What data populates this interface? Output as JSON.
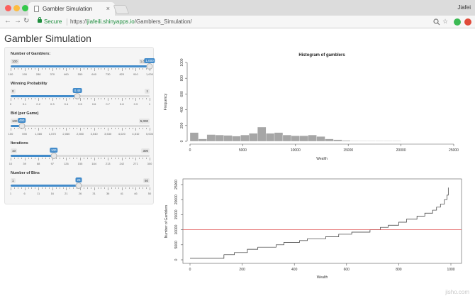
{
  "browser": {
    "tab_title": "Gambler Simulation",
    "tab_close": "×",
    "user_name": "Jiafei",
    "secure_label": "Secure",
    "url_scheme": "https://",
    "url_host": "jiafeili.shinyapps.io",
    "url_path": "/Gamblers_Simulation/"
  },
  "app": {
    "title": "Gambler Simulation",
    "watermark": "jisho.com"
  },
  "controls": [
    {
      "label": "Number of Gamblers:",
      "min_label": "100",
      "max_label": "1,000",
      "value_label": "1,000",
      "fraction": 1.0,
      "ticks": [
        "100",
        "190",
        "280",
        "370",
        "460",
        "550",
        "640",
        "730",
        "820",
        "910",
        "1,000"
      ]
    },
    {
      "label": "Winning Probability",
      "min_label": "0",
      "max_label": "1",
      "value_label": "0.48",
      "fraction": 0.48,
      "ticks": [
        "0",
        "0.1",
        "0.2",
        "0.3",
        "0.4",
        "0.5",
        "0.6",
        "0.7",
        "0.8",
        "0.9",
        "1"
      ]
    },
    {
      "label": "Bid (per Game)",
      "min_label": "100",
      "max_label": "5,000",
      "value_label": "490",
      "fraction": 0.08,
      "ticks": [
        "100",
        "590",
        "1,080",
        "1,570",
        "2,060",
        "2,550",
        "3,040",
        "3,530",
        "4,020",
        "4,510",
        "5,000"
      ]
    },
    {
      "label": "Iterations",
      "min_label": "10",
      "max_label": "300",
      "value_label": "100",
      "fraction": 0.31,
      "ticks": [
        "10",
        "39",
        "68",
        "97",
        "126",
        "155",
        "184",
        "213",
        "242",
        "271",
        "300"
      ]
    },
    {
      "label": "Number of Bins",
      "min_label": "1",
      "max_label": "50",
      "value_label": "25",
      "fraction": 0.49,
      "ticks": [
        "1",
        "6",
        "11",
        "16",
        "21",
        "26",
        "31",
        "36",
        "41",
        "46",
        "50"
      ]
    }
  ],
  "chart_data": [
    {
      "type": "bar",
      "title": "Histogram of gamblers",
      "xlabel": "Wealth",
      "ylabel": "Frequency",
      "xlim": [
        0,
        25000
      ],
      "ylim": [
        0,
        1000
      ],
      "xticks": [
        "0",
        "5000",
        "10000",
        "15000",
        "20000",
        "25000"
      ],
      "yticks": [
        "0",
        "200",
        "400",
        "600",
        "800",
        "1000"
      ],
      "bin_width": 800,
      "bin_starts": [
        0,
        800,
        1600,
        2400,
        3200,
        4000,
        4800,
        5600,
        6400,
        7200,
        8000,
        8800,
        9600,
        10400,
        11200,
        12000,
        12800,
        13600,
        14400,
        15200,
        16000,
        16800,
        17600,
        18400,
        19200
      ],
      "values": [
        110,
        30,
        85,
        80,
        75,
        65,
        80,
        100,
        180,
        100,
        110,
        80,
        70,
        70,
        80,
        60,
        30,
        20,
        10,
        5,
        5,
        5,
        5,
        5,
        5
      ],
      "grid": false,
      "color": "#a6a6a6"
    },
    {
      "type": "line",
      "title": "",
      "xlabel": "Wealth",
      "ylabel": "Number of Gamblers",
      "xlim": [
        0,
        1000
      ],
      "ylim": [
        0,
        25000
      ],
      "xticks": [
        "0",
        "200",
        "400",
        "600",
        "800",
        "1000"
      ],
      "yticks": [
        "0",
        "5000",
        "10000",
        "15000",
        "20000",
        "25000"
      ],
      "reference_line": 10000,
      "reference_color": "#e05555",
      "x": [
        0,
        110,
        130,
        170,
        220,
        260,
        330,
        360,
        420,
        450,
        520,
        570,
        620,
        690,
        730,
        760,
        800,
        830,
        870,
        900,
        930,
        945,
        960,
        975,
        985,
        990
      ],
      "y": [
        500,
        500,
        1700,
        2400,
        3500,
        4200,
        5000,
        5800,
        6400,
        7000,
        7700,
        8500,
        9200,
        10000,
        10800,
        11500,
        12500,
        13500,
        14500,
        15500,
        16500,
        17500,
        18500,
        20000,
        21500,
        24000
      ]
    }
  ]
}
